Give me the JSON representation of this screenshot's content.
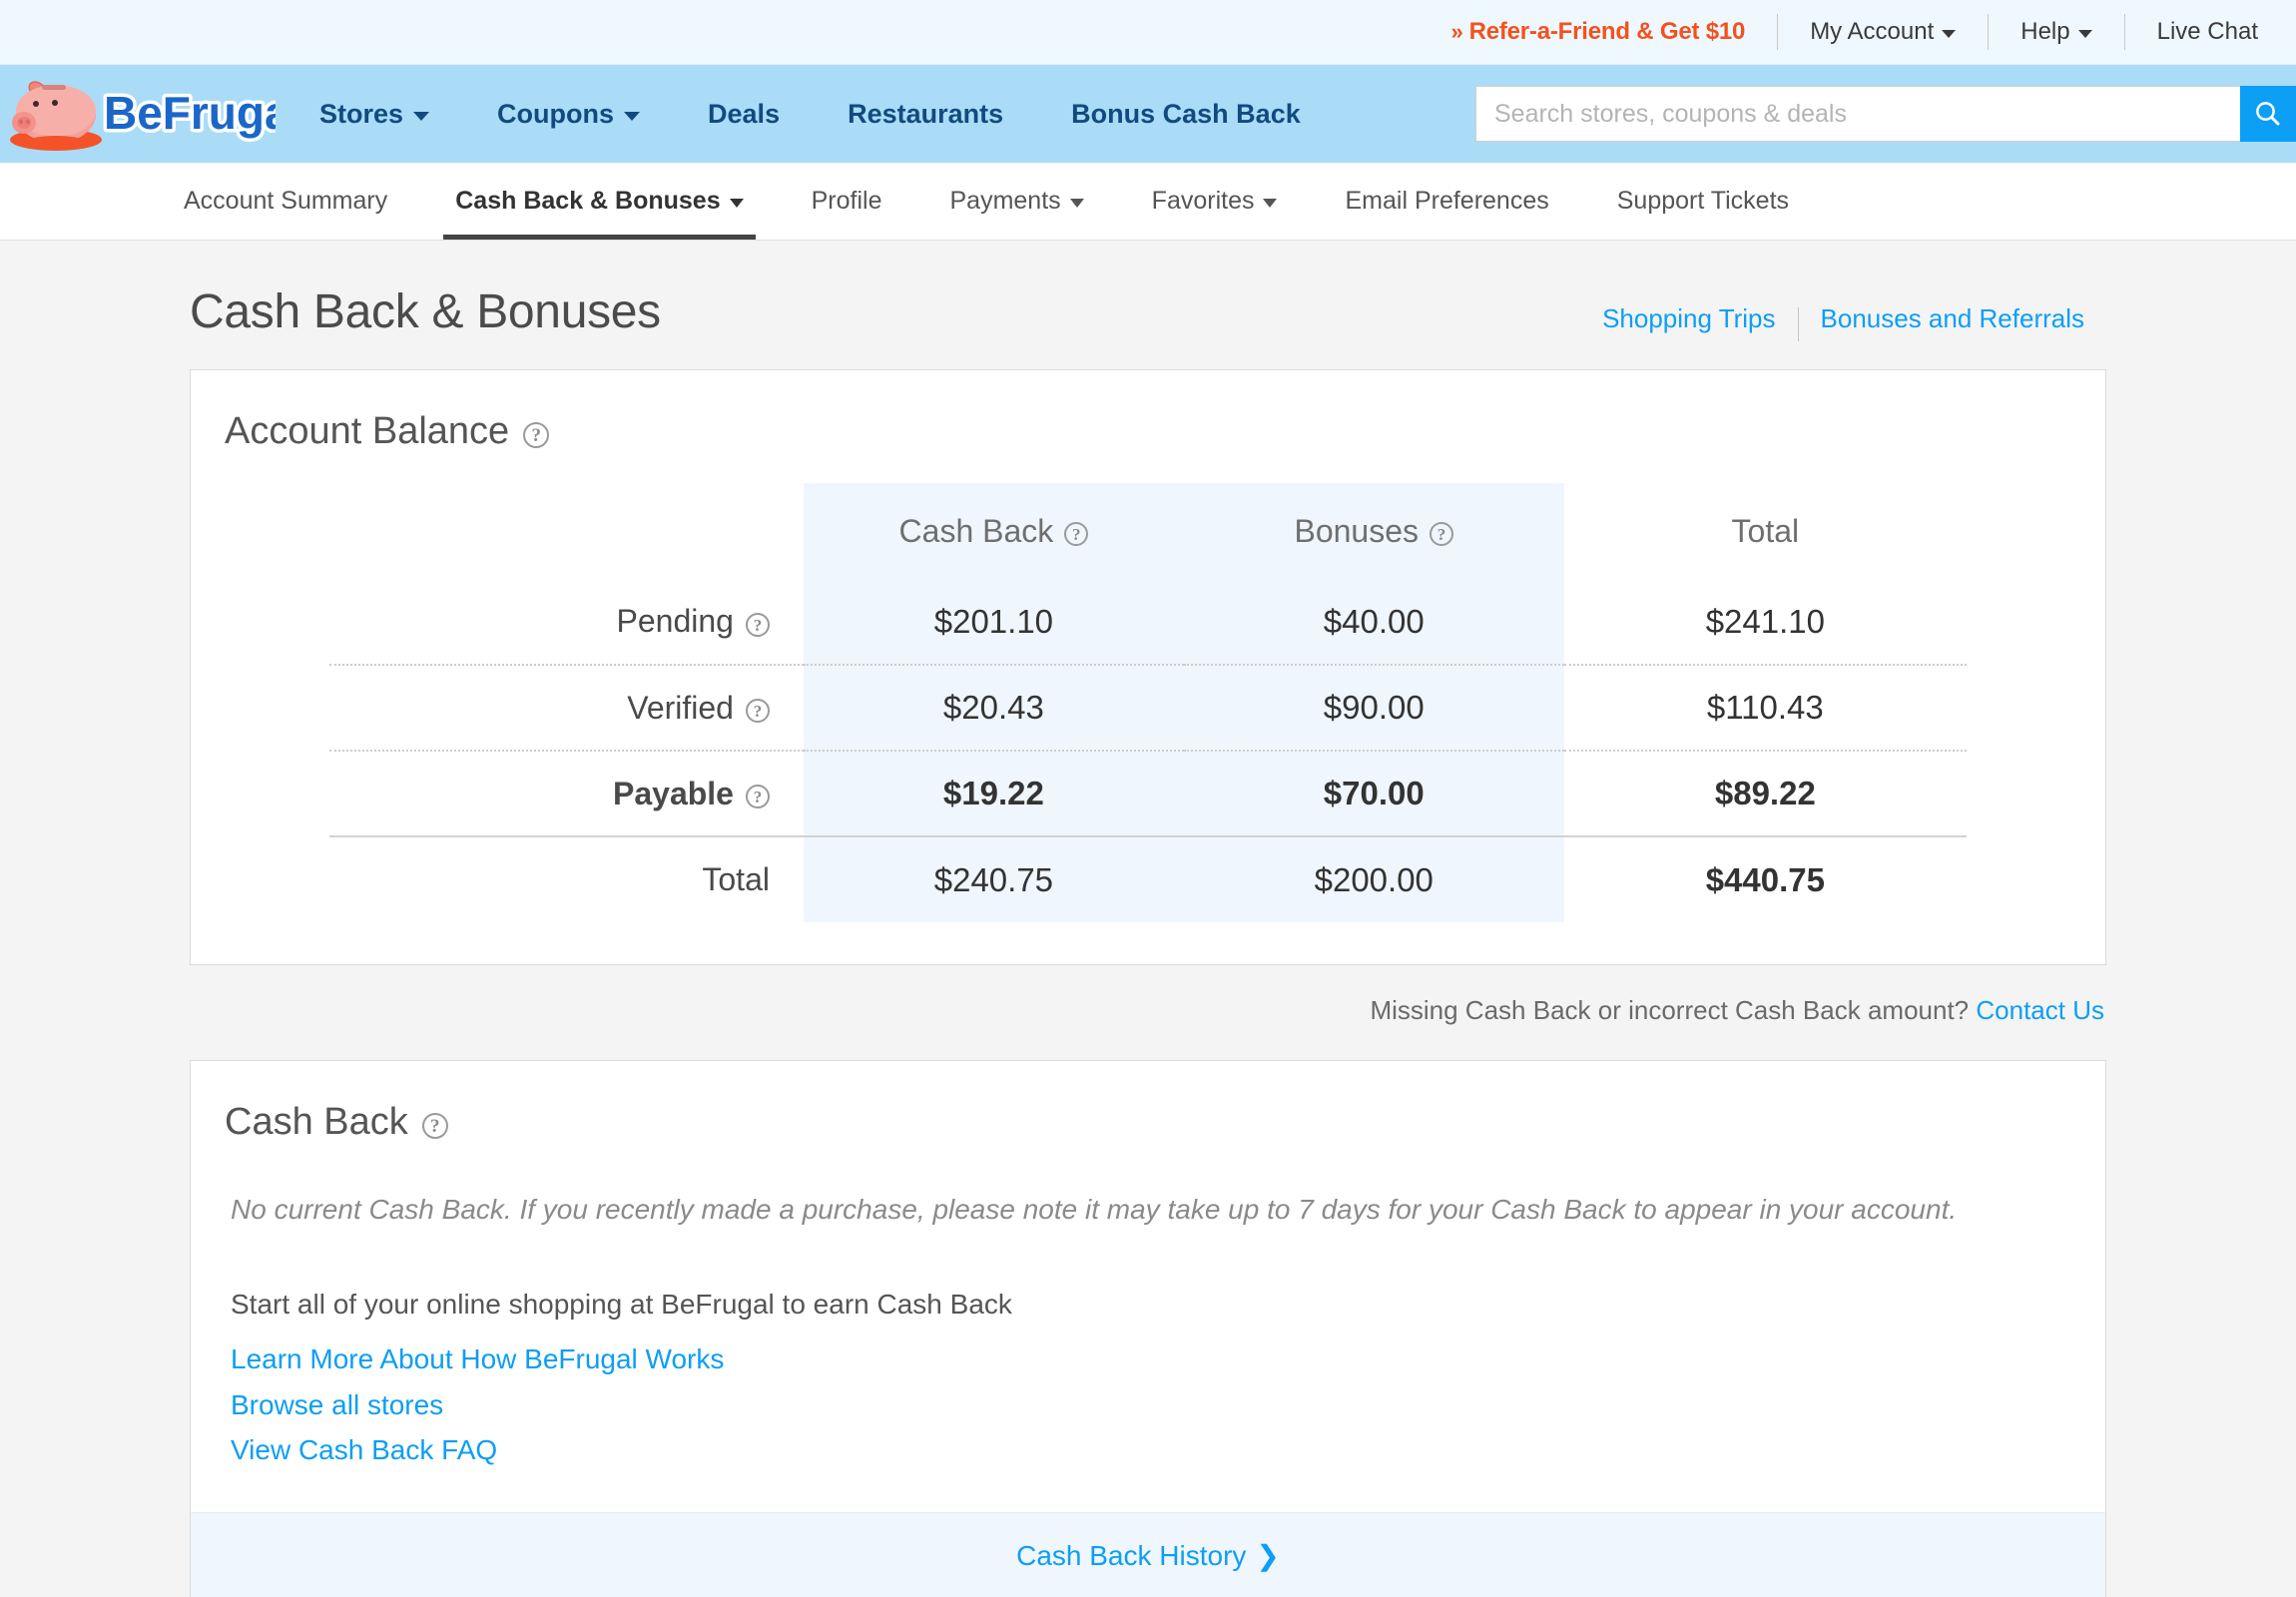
{
  "topbar": {
    "refer_prefix": "»",
    "refer_label": "Refer-a-Friend & Get $10",
    "my_account": "My Account",
    "help": "Help",
    "live_chat": "Live Chat",
    "refer_color": "#f4511e"
  },
  "mainnav": {
    "logo_text": "BeFrugal",
    "links": [
      {
        "label": "Stores",
        "has_caret": true
      },
      {
        "label": "Coupons",
        "has_caret": true
      },
      {
        "label": "Deals",
        "has_caret": false
      },
      {
        "label": "Restaurants",
        "has_caret": false
      },
      {
        "label": "Bonus Cash Back",
        "has_caret": false
      }
    ],
    "search_placeholder": "Search stores, coupons & deals",
    "search_value": "",
    "search_icon": "search-icon",
    "bar_color": "#aadcf7",
    "link_color": "#124a80"
  },
  "subnav": {
    "items": [
      {
        "label": "Account Summary",
        "has_caret": false,
        "active": false
      },
      {
        "label": "Cash Back & Bonuses",
        "has_caret": true,
        "active": true
      },
      {
        "label": "Profile",
        "has_caret": false,
        "active": false
      },
      {
        "label": "Payments",
        "has_caret": true,
        "active": false
      },
      {
        "label": "Favorites",
        "has_caret": true,
        "active": false
      },
      {
        "label": "Email Preferences",
        "has_caret": false,
        "active": false
      },
      {
        "label": "Support Tickets",
        "has_caret": false,
        "active": false
      }
    ]
  },
  "page": {
    "title": "Cash Back & Bonuses",
    "head_links": [
      {
        "label": "Shopping Trips"
      },
      {
        "label": "Bonuses and Referrals"
      }
    ],
    "link_color": "#0d9ef5"
  },
  "account_balance": {
    "title": "Account Balance",
    "title_help_icon": "help-circle-icon",
    "columns": [
      {
        "label": "",
        "help": false
      },
      {
        "label": "Cash Back",
        "help": true
      },
      {
        "label": "Bonuses",
        "help": true
      },
      {
        "label": "Total",
        "help": false
      }
    ],
    "rows": [
      {
        "label": "Pending",
        "help": true,
        "cash_back": "$201.10",
        "bonuses": "$40.00",
        "total": "$241.10",
        "bold": false,
        "total_green": false
      },
      {
        "label": "Verified",
        "help": true,
        "cash_back": "$20.43",
        "bonuses": "$90.00",
        "total": "$110.43",
        "bold": false,
        "total_green": false
      },
      {
        "label": "Payable",
        "help": true,
        "cash_back": "$19.22",
        "bonuses": "$70.00",
        "total": "$89.22",
        "bold": true,
        "total_green": false
      },
      {
        "label": "Total",
        "help": false,
        "cash_back": "$240.75",
        "bonuses": "$200.00",
        "total": "$440.75",
        "bold": false,
        "total_green": true
      }
    ],
    "highlight_color": "#eff6fd",
    "grand_total_color": "#00a81e"
  },
  "missing_note": {
    "text": "Missing Cash Back or incorrect Cash Back amount?",
    "link_label": "Contact Us"
  },
  "cash_back": {
    "title": "Cash Back",
    "title_help_icon": "help-circle-icon",
    "empty_message": "No current Cash Back. If you recently made a purchase, please note it may take up to 7 days for your Cash Back to appear in your account.",
    "start_text": "Start all of your online shopping at BeFrugal to earn Cash Back",
    "links": [
      {
        "label": "Learn More About How BeFrugal Works"
      },
      {
        "label": "Browse all stores"
      },
      {
        "label": "View Cash Back FAQ"
      }
    ],
    "footer_link": "Cash Back History",
    "footer_chevron": "❯"
  }
}
